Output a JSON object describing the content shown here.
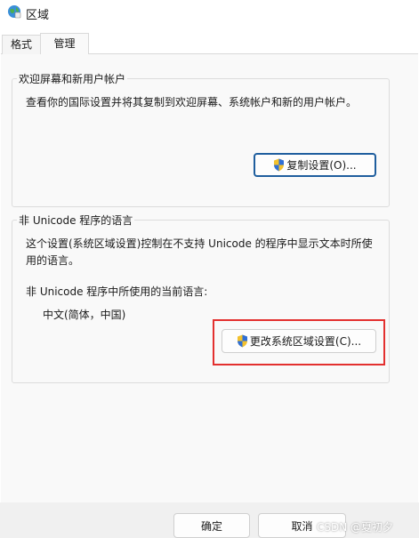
{
  "window": {
    "title": "区域",
    "icon": "globe-region-icon"
  },
  "tabs": [
    {
      "label": "格式",
      "active": false
    },
    {
      "label": "管理",
      "active": true
    }
  ],
  "welcome_group": {
    "legend": "欢迎屏幕和新用户帐户",
    "description": "查看你的国际设置并将其复制到欢迎屏幕、系统帐户和新的用户帐户。",
    "copy_button": "复制设置(O)..."
  },
  "non_unicode_group": {
    "legend": "非 Unicode 程序的语言",
    "description": "这个设置(系统区域设置)控制在不支持 Unicode 的程序中显示文本时所使用的语言。",
    "current_label": "非 Unicode 程序中所使用的当前语言:",
    "current_value": "中文(简体，中国)",
    "change_button": "更改系统区域设置(C)..."
  },
  "footer": {
    "ok": "确定",
    "cancel": "取消",
    "watermark": "CSDN @夏初夕"
  },
  "colors": {
    "accent": "#1f5e9e",
    "highlight": "#e3302f"
  }
}
